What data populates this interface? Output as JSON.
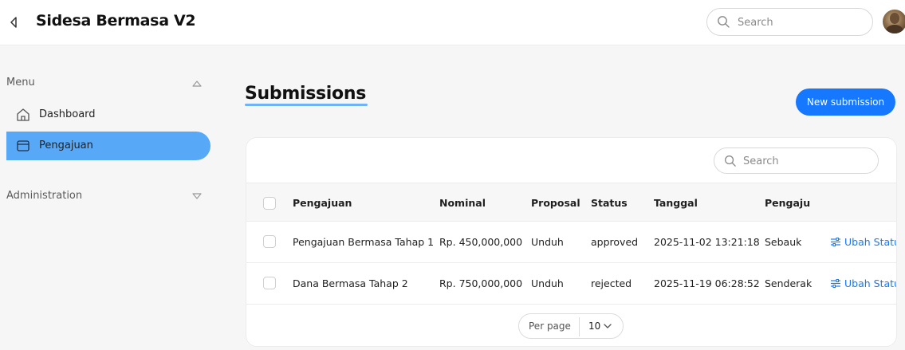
{
  "app": {
    "title": "Sidesa Bermasa V2"
  },
  "header": {
    "search_placeholder": "Search"
  },
  "sidebar": {
    "sections": [
      {
        "label": "Menu",
        "expanded": true
      },
      {
        "label": "Administration",
        "expanded": false
      }
    ],
    "items": [
      {
        "label": "Dashboard",
        "icon": "home-icon",
        "active": false
      },
      {
        "label": "Pengajuan",
        "icon": "inbox-icon",
        "active": true
      }
    ]
  },
  "main": {
    "title": "Submissions",
    "new_button": "New submission",
    "search_placeholder": "Search"
  },
  "table": {
    "columns": [
      "Pengajuan",
      "Nominal",
      "Proposal",
      "Status",
      "Tanggal",
      "Pengaju"
    ],
    "rows": [
      {
        "pengajuan": "Pengajuan Bermasa Tahap 1",
        "nominal": "Rp. 450,000,000",
        "proposal": "Unduh",
        "status": "approved",
        "tanggal": "2025-11-02 13:21:18",
        "pengaju": "Sebauk",
        "action": "Ubah Statu"
      },
      {
        "pengajuan": "Dana Bermasa Tahap 2",
        "nominal": "Rp. 750,000,000",
        "proposal": "Unduh",
        "status": "rejected",
        "tanggal": "2025-11-19 06:28:52",
        "pengaju": "Senderak",
        "action": "Ubah Statu"
      }
    ]
  },
  "pagination": {
    "label": "Per page",
    "value": "10"
  },
  "colors": {
    "accent": "#1677ff",
    "active_nav": "#58a8f8",
    "underline": "#6fb2f6",
    "background": "#f6f6f6"
  }
}
